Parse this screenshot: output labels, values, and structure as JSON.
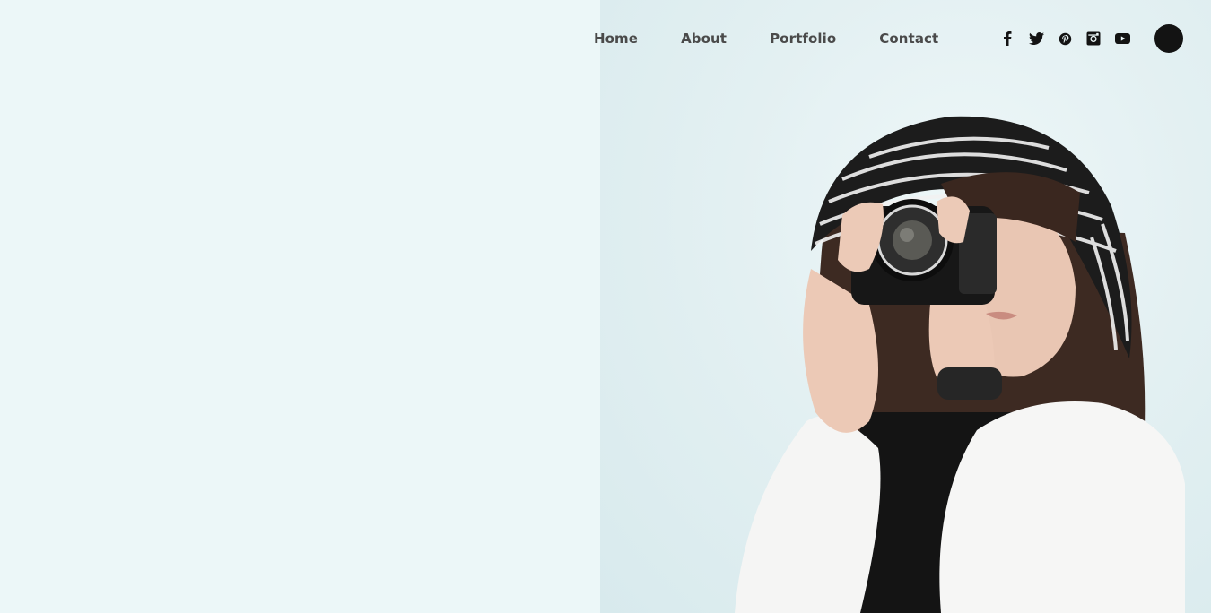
{
  "nav": {
    "items": [
      {
        "label": "Home"
      },
      {
        "label": "About"
      },
      {
        "label": "Portfolio"
      },
      {
        "label": "Contact"
      }
    ]
  },
  "socials": [
    {
      "icon": "facebook-icon"
    },
    {
      "icon": "twitter-icon"
    },
    {
      "icon": "pinterest-icon"
    },
    {
      "icon": "instagram-icon"
    },
    {
      "icon": "youtube-icon"
    }
  ],
  "colors": {
    "background": "#ecf7f8",
    "nav_text": "#4a4a4a",
    "icon": "#131313",
    "menu_button": "#131313"
  }
}
